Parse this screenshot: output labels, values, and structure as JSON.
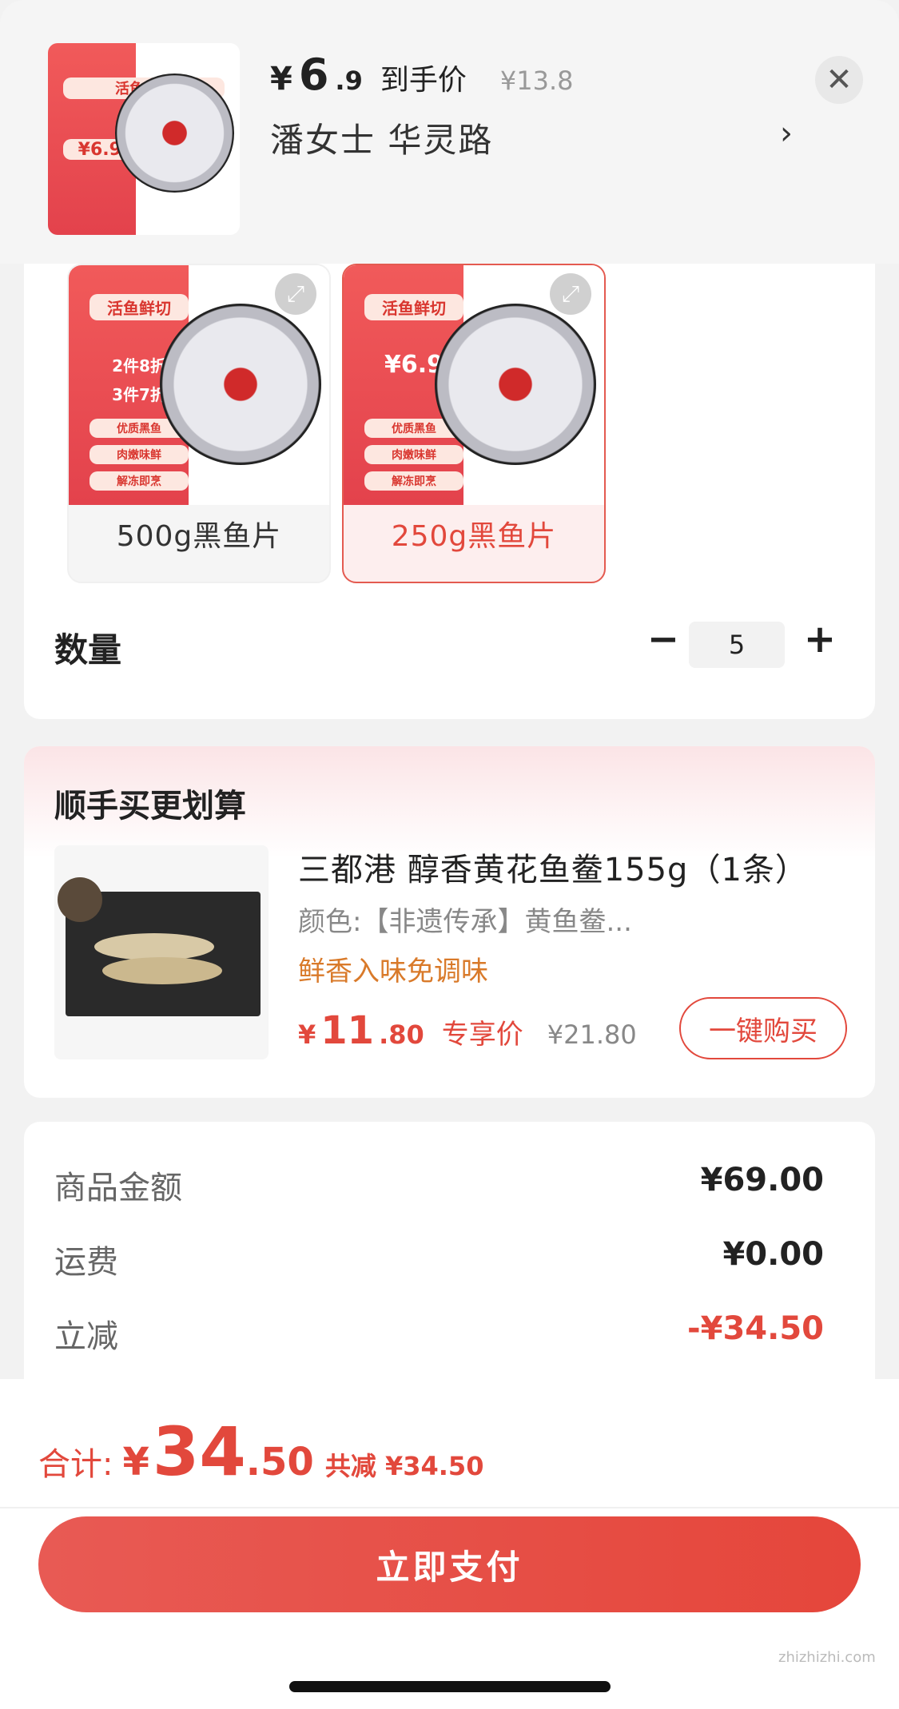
{
  "header": {
    "price_yen": "¥",
    "price_int": "6",
    "price_dec": ".9",
    "price_label": "到手价",
    "original_price": "¥13.8",
    "address": "潘女士  华灵路",
    "address_chevron": "›",
    "close_symbol": "✕"
  },
  "sku_options": [
    {
      "label": "500g黑鱼片",
      "selected": false,
      "promo_tags": [
        "活鱼鲜切",
        "2件8折",
        "3件7折",
        "优质黑鱼",
        "肉嫩味鲜",
        "解冻即烹"
      ]
    },
    {
      "label": "250g黑鱼片",
      "selected": true,
      "promo_tags": [
        "活鱼鲜切",
        "¥6.9",
        "优质黑鱼",
        "肉嫩味鲜",
        "解冻即烹"
      ]
    }
  ],
  "quantity": {
    "label": "数量",
    "value": "5",
    "minus_symbol": "−",
    "plus_symbol": "+"
  },
  "recommend": {
    "title": "顺手买更划算",
    "product_name": "三都港 醇香黄花鱼鲞155g（1条）",
    "spec": "颜色:【非遗传承】黄鱼鲞...",
    "tag": "鲜香入味免调味",
    "price_yen": "¥",
    "price_int": "11",
    "price_dec": ".80",
    "price_label": "专享价",
    "original_price": "¥21.80",
    "buy_label": "一键购买"
  },
  "summary": {
    "rows": [
      {
        "label": "商品金额",
        "value": "¥69.00"
      },
      {
        "label": "运费",
        "value": "¥0.00"
      },
      {
        "label": "立减",
        "value": "-¥34.50"
      }
    ]
  },
  "footer": {
    "total_label": "合计:",
    "total_yen": "¥",
    "total_int": "34",
    "total_dec": ".50",
    "saving": "共减 ¥34.50",
    "pay_label": "立即支付",
    "watermark": "zhizhizhi.com"
  },
  "colors": {
    "accent": "#e2483c",
    "tag_orange": "#d97a2a"
  },
  "icons": {
    "close": "close-icon",
    "chevron": "chevron-right-icon",
    "expand": "expand-icon",
    "minus": "minus-icon",
    "plus": "plus-icon"
  }
}
